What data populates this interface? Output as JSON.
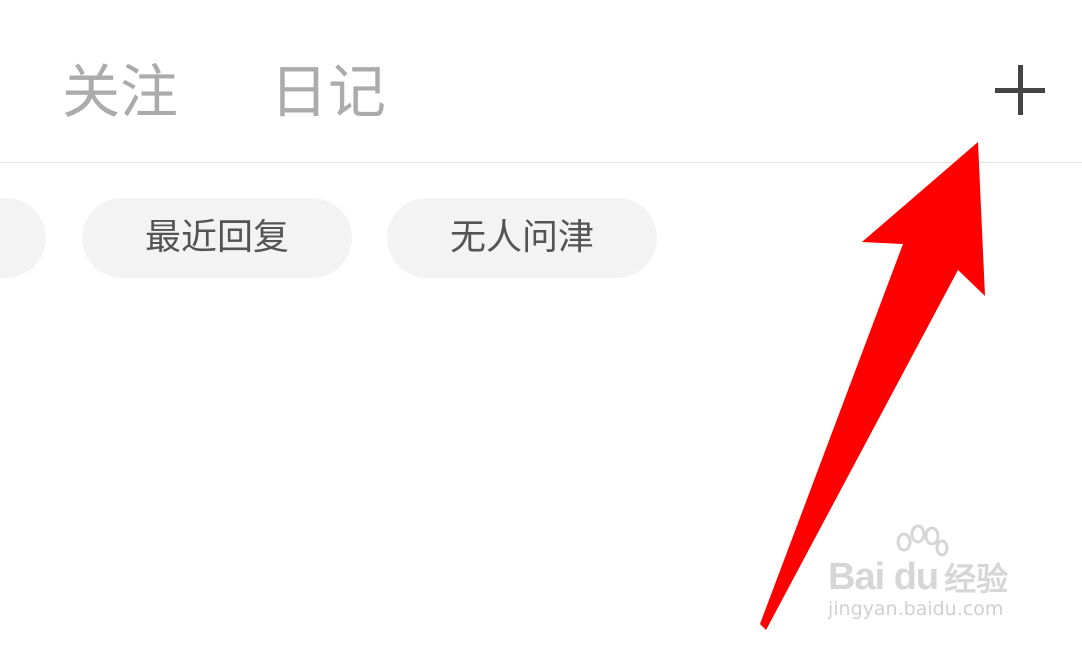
{
  "tabs": [
    {
      "label": "关注"
    },
    {
      "label": "日记"
    }
  ],
  "header": {
    "add_icon": "plus-icon"
  },
  "filter_chips": [
    {
      "label": ""
    },
    {
      "label": "最近回复"
    },
    {
      "label": "无人问津"
    }
  ],
  "annotation": {
    "arrow_color": "#ff0000"
  },
  "watermark": {
    "brand": "Bai du",
    "product": "经验",
    "url": "jingyan.baidu.com"
  },
  "colors": {
    "tab_text": "#ababab",
    "chip_background": "#f3f3f3",
    "chip_text": "#545454",
    "divider": "#e4e4e4",
    "icon": "#444444"
  }
}
